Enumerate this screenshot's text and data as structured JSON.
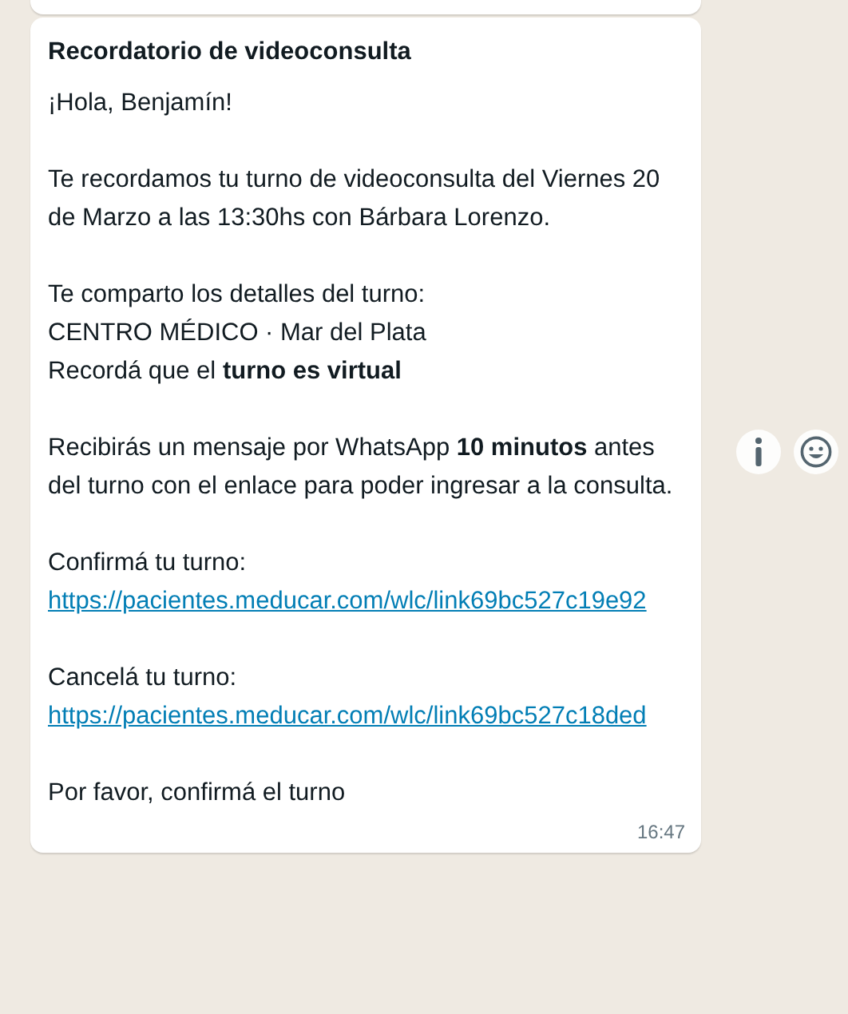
{
  "message": {
    "title": "Recordatorio de videoconsulta",
    "blocks": [
      {
        "lines": [
          {
            "kind": "text",
            "text": "¡Hola, Benjamín!"
          }
        ]
      },
      {
        "lines": [
          {
            "kind": "text",
            "text": "Te recordamos tu turno de videoconsulta del Viernes 20 de Marzo a las 13:30hs con Bárbara Lorenzo."
          }
        ]
      },
      {
        "lines": [
          {
            "kind": "text",
            "text": "Te comparto los detalles del turno:"
          },
          {
            "kind": "text",
            "text": "CENTRO MÉDICO · Mar del Plata"
          },
          {
            "kind": "text",
            "text": "Recordá que el **turno es virtual**"
          }
        ]
      },
      {
        "lines": [
          {
            "kind": "text",
            "text": "Recibirás un mensaje por WhatsApp **10 minutos** antes del turno con el enlace para poder ingresar a la consulta."
          }
        ]
      },
      {
        "lines": [
          {
            "kind": "text",
            "text": "Confirmá tu turno:"
          },
          {
            "kind": "link",
            "text": "https://pacientes.meducar.com/wlc/link69bc527c19e92"
          }
        ]
      },
      {
        "lines": [
          {
            "kind": "text",
            "text": "Cancelá tu turno:"
          },
          {
            "kind": "link",
            "text": "https://pacientes.meducar.com/wlc/link69bc527c18ded"
          }
        ]
      },
      {
        "lines": [
          {
            "kind": "text",
            "text": "Por favor, confirmá el turno"
          }
        ]
      }
    ],
    "time": "16:47"
  }
}
